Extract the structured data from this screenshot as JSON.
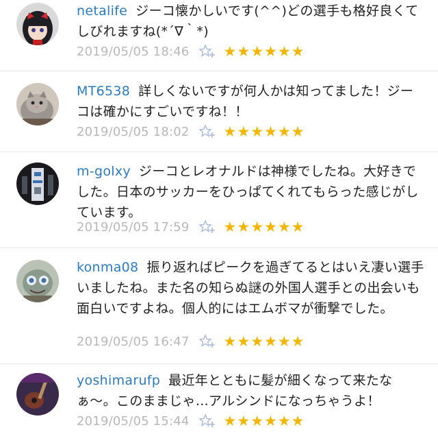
{
  "comments": [
    {
      "user": "netalife",
      "text": "ジーコ懐かしいです(^^)どの選手も格好良くてしびれますね(*´∇｀*)",
      "time": "2019/05/05 18:46",
      "stars": "★★★★★★",
      "avatar": "anime-girl-avatar"
    },
    {
      "user": "MT6538",
      "text": "詳しくないですが何人かは知ってました！ジーコは確かにすごいですね！！",
      "time": "2019/05/05 18:02",
      "stars": "★★★★★★",
      "avatar": "cat-avatar"
    },
    {
      "user": "m-golxy",
      "text": "ジーコとレオナルドは神様でしたね。大好きでした。日本のサッカーをひっぱてくれてもらった感じがしています。",
      "time": "2019/05/05 17:59",
      "stars": "★★★★★★",
      "avatar": "figure-avatar"
    },
    {
      "user": "konma08",
      "text": "振り返ればピークを過ぎてるとはいえ凄い選手いましたね。また名の知らぬ謎の外国人選手との出会いも面白いですよね。個人的にはエムボマが衝撃でした。",
      "time": "2019/05/05 16:47",
      "stars": "★★★★★★",
      "avatar": "character-avatar"
    },
    {
      "user": "yoshimarufp",
      "text": "最近年とともに髪が細くなって来たなぁ〜。このままじゃ…アルシンドになっちゃうよ！",
      "time": "2019/05/05 15:44",
      "stars": "★★★★★★",
      "avatar": "guitar-avatar"
    }
  ],
  "colors": {
    "username": "#2b7bc1",
    "timestamp": "#b8b8b8",
    "star": "#f2b600",
    "divider": "#e6e6e6"
  },
  "icons": {
    "favorite": "star-plus-icon"
  }
}
